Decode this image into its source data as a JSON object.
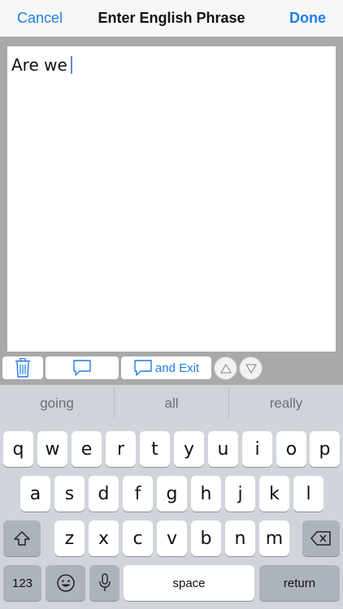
{
  "nav": {
    "cancel_label": "Cancel",
    "title": "Enter English Phrase",
    "done_label": "Done"
  },
  "editor": {
    "text": "Are we"
  },
  "toolbar": {
    "trash_icon": "trash-icon",
    "speak_icon": "speech-bubble-icon",
    "speak_exit_label": "and Exit",
    "up_icon": "arrow-up-icon",
    "down_icon": "arrow-down-icon",
    "accent_color": "#1f7de6"
  },
  "suggestions": [
    "going",
    "all",
    "really"
  ],
  "keyboard": {
    "row1": [
      "q",
      "w",
      "e",
      "r",
      "t",
      "y",
      "u",
      "i",
      "o",
      "p"
    ],
    "row2": [
      "a",
      "s",
      "d",
      "f",
      "g",
      "h",
      "j",
      "k",
      "l"
    ],
    "row3": [
      "z",
      "x",
      "c",
      "v",
      "b",
      "n",
      "m"
    ],
    "numbers_label": "123",
    "space_label": "space",
    "return_label": "return"
  }
}
